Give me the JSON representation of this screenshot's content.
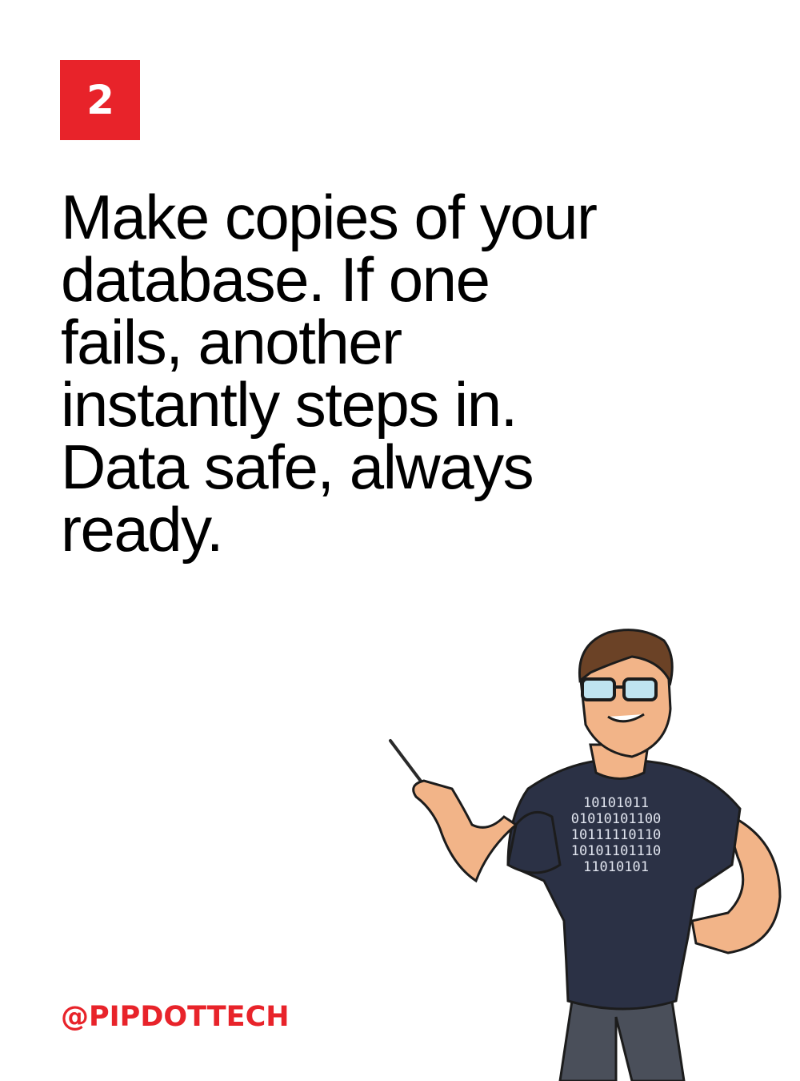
{
  "slide": {
    "number": "2",
    "headline": "Make copies of your database. If one fails, another instantly steps in. Data safe, always ready.",
    "handle": "@PIPDOTTECH"
  },
  "illustration": {
    "subject": "cartoon developer pointing with a stick",
    "shirt_lines": [
      "10101011",
      "01010101100",
      "10111110110",
      "10101101110",
      "11010101"
    ]
  },
  "colors": {
    "accent": "#e8232a",
    "text": "#000000",
    "background": "#ffffff"
  }
}
